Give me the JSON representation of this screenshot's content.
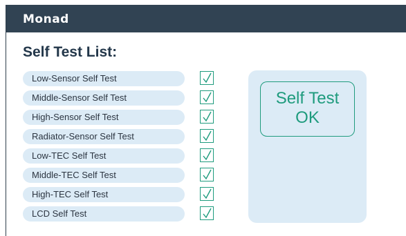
{
  "app": {
    "title": "Monad"
  },
  "page": {
    "title": "Self Test List:"
  },
  "self_tests": [
    {
      "label": "Low-Sensor Self Test",
      "checked": true
    },
    {
      "label": "Middle-Sensor Self Test",
      "checked": true
    },
    {
      "label": "High-Sensor Self Test",
      "checked": true
    },
    {
      "label": "Radiator-Sensor Self Test",
      "checked": true
    },
    {
      "label": "Low-TEC Self Test",
      "checked": true
    },
    {
      "label": "Middle-TEC Self Test",
      "checked": true
    },
    {
      "label": "High-TEC Self Test",
      "checked": true
    },
    {
      "label": "LCD Self Test",
      "checked": true
    }
  ],
  "result": {
    "line1": "Self Test",
    "line2": "OK"
  },
  "colors": {
    "titlebar": "#314353",
    "pill_background": "#dcebf6",
    "accent_green": "#1e9b7d",
    "title_text": "#23374a"
  },
  "icons": {
    "check": "checkmark-icon"
  }
}
